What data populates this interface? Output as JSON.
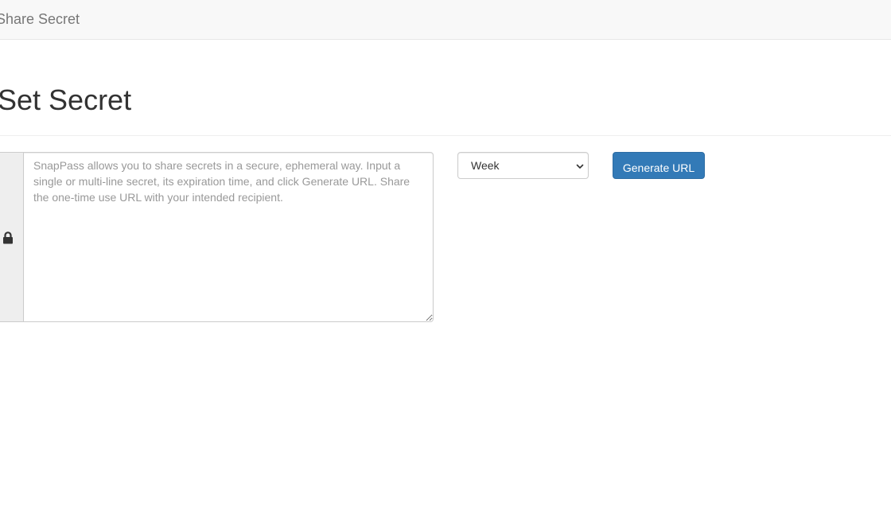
{
  "navbar": {
    "brand": "Share Secret"
  },
  "header": {
    "title": "Set Secret"
  },
  "form": {
    "secret_placeholder": "SnapPass allows you to share secrets in a secure, ephemeral way. Input a single or multi-line secret, its expiration time, and click Generate URL. Share the one-time use URL with your intended recipient.",
    "secret_value": "",
    "addon_icon": "lock-icon",
    "ttl_selected": "Week",
    "submit_label": "Generate URL"
  },
  "colors": {
    "primary_button": "#337ab7",
    "navbar_bg": "#f8f8f8"
  }
}
